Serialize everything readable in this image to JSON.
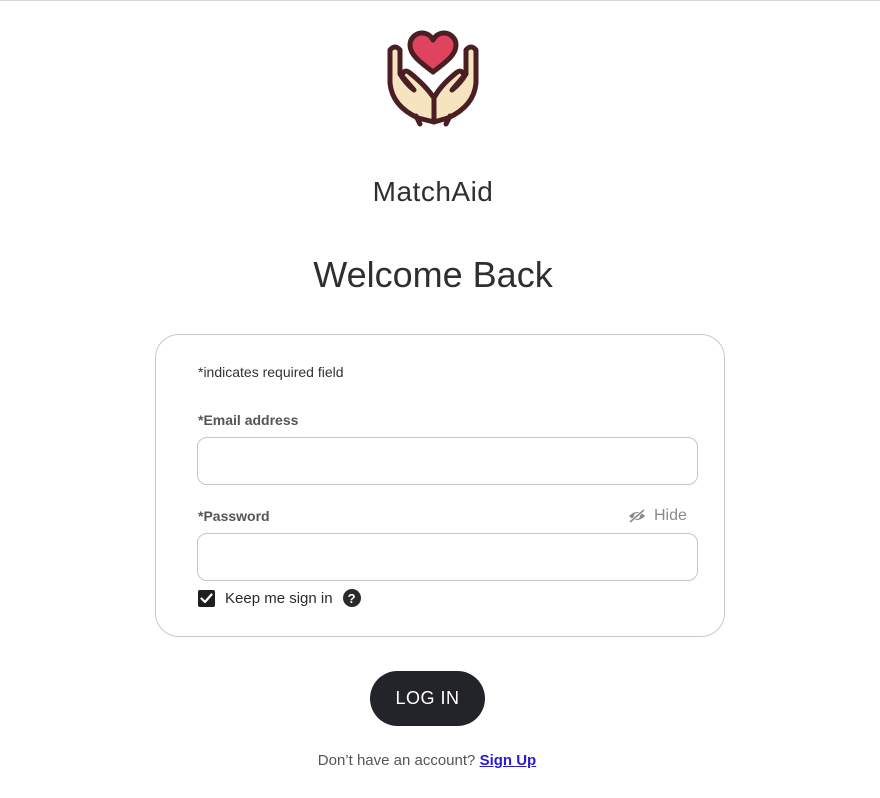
{
  "app": {
    "name": "MatchAid"
  },
  "logo": {
    "icon": "hands-heart-icon",
    "heart_color": "#e0435f",
    "hands_color": "#f6e3bf",
    "outline_color": "#4a1f24"
  },
  "page": {
    "heading": "Welcome Back"
  },
  "form": {
    "required_note": "*indicates required field",
    "email": {
      "label": "*Email address",
      "value": "",
      "placeholder": ""
    },
    "password": {
      "label": "*Password",
      "value": "",
      "placeholder": "",
      "toggle_label": "Hide",
      "toggle_icon": "eye-slash-icon"
    },
    "keep_signed_in": {
      "label": "Keep me sign in",
      "checked": true,
      "help_icon": "question-circle-icon"
    }
  },
  "actions": {
    "login_label": "LOG IN"
  },
  "footer": {
    "prompt": "Don’t have an account?",
    "signup_label": "Sign Up"
  },
  "colors": {
    "button_bg": "#23242a",
    "link": "#2b1ad1"
  }
}
